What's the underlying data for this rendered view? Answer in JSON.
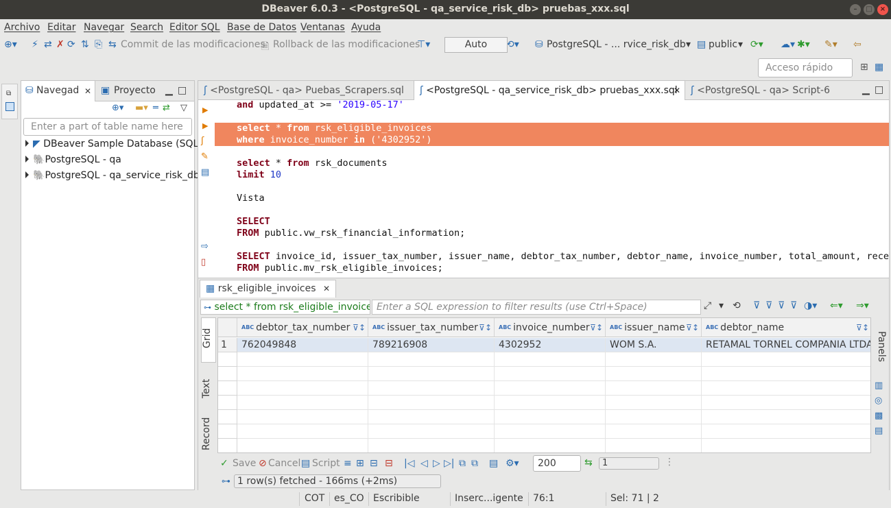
{
  "window": {
    "title": "DBeaver 6.0.3 - <PostgreSQL - qa_service_risk_db> pruebas_xxx.sql"
  },
  "menu": [
    "Archivo",
    "Editar",
    "Navegar",
    "Search",
    "Editor SQL",
    "Base de Datos",
    "Ventanas",
    "Ayuda"
  ],
  "toolbar": {
    "commit_label": "Commit de las modificaciones",
    "rollback_label": "Rollback de las modificaciones",
    "transaction_mode": "Auto",
    "connection": "PostgreSQL - ... rvice_risk_db",
    "schema": "public",
    "quick_access_placeholder": "Acceso rápido"
  },
  "navigator": {
    "tab_label": "Navegad",
    "project_tab_label": "Proyecto",
    "search_placeholder": "Enter a part of table name here",
    "items": [
      {
        "label": "DBeaver Sample Database (SQLi"
      },
      {
        "label": "PostgreSQL - qa"
      },
      {
        "label": "PostgreSQL - qa_service_risk_db"
      }
    ]
  },
  "editor": {
    "tabs": [
      {
        "label": "<PostgreSQL - qa> Puebas_Scrapers.sql"
      },
      {
        "label": "<PostgreSQL - qa_service_risk_db> pruebas_xxx.sql"
      },
      {
        "label": "<PostgreSQL - qa> Script-6"
      }
    ]
  },
  "results": {
    "tab_label": "rsk_eligible_invoices",
    "query_preview": "select * from rsk_eligible_invoices",
    "filter_placeholder": "Enter a SQL expression to filter results (use Ctrl+Space)",
    "view_tabs": [
      "Grid",
      "Text",
      "Record"
    ],
    "panels_label": "Panels",
    "columns": [
      "debtor_tax_number",
      "issuer_tax_number",
      "invoice_number",
      "issuer_name",
      "debtor_name"
    ],
    "rows": [
      {
        "num": "1",
        "cells": [
          "762049848",
          "789216908",
          "4302952",
          "WOM S.A.",
          "RETAMAL TORNEL COMPANIA LTDA"
        ]
      }
    ],
    "actions": {
      "save": "Save",
      "cancel": "Cancel",
      "script": "Script"
    },
    "fetch_size": "200",
    "page": "1",
    "status": "1 row(s) fetched - 166ms (+2ms)"
  },
  "statusbar": {
    "timezone": "COT",
    "locale": "es_CO",
    "mode": "Escribible",
    "insert_mode": "Inserc...igente",
    "position": "76:1",
    "selection": "Sel: 71 | 2"
  }
}
